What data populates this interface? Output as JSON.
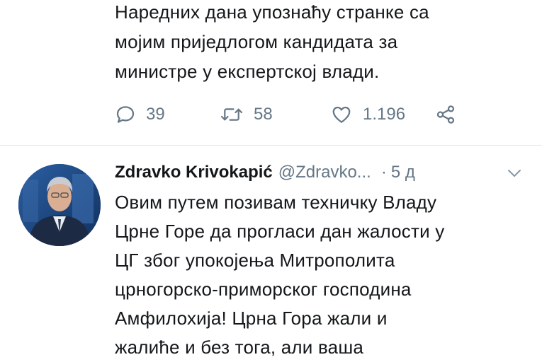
{
  "previous_tweet": {
    "text": "Наредних дана упознаћу странке са\nмојим приједлогом кандидата за\nминистре у експертској влади.",
    "actions": {
      "reply_icon": "reply-icon",
      "reply_count": "39",
      "retweet_icon": "retweet-icon",
      "retweet_count": "58",
      "like_icon": "heart-icon",
      "like_count": "1.196",
      "share_icon": "share-icon"
    }
  },
  "tweet": {
    "author_name": "Zdravko Krivokapić",
    "handle": "@Zdravko...",
    "separator": "·",
    "time": "5 д",
    "menu_icon": "chevron-down-icon",
    "text": "Овим путем позивам техничку Владу\nЦрне Горе да прогласи дан жалости у\nЦГ због упокојења Митрополита\nцрногорско-приморског господина\nАмфилохија! Црна Гора жали и\nжалиће и без тога, али ваша"
  },
  "colors": {
    "text": "#14171a",
    "muted": "#657786",
    "divider": "#e1e8ed"
  }
}
